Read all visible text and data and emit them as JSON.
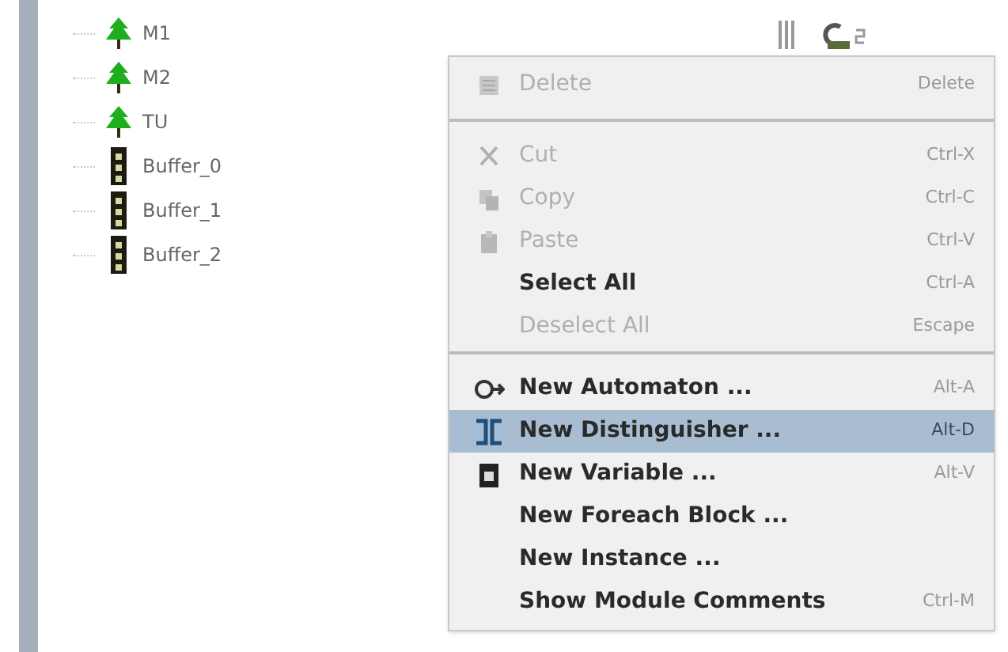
{
  "tree": {
    "items": [
      {
        "label": "M1",
        "kind": "tree"
      },
      {
        "label": "M2",
        "kind": "tree"
      },
      {
        "label": "TU",
        "kind": "tree"
      },
      {
        "label": "Buffer_0",
        "kind": "buffer"
      },
      {
        "label": "Buffer_1",
        "kind": "buffer"
      },
      {
        "label": "Buffer_2",
        "kind": "buffer"
      }
    ]
  },
  "menu": {
    "groups": [
      [
        {
          "label": "Delete",
          "shortcut": "Delete",
          "disabled": true,
          "bold": false,
          "selected": false
        }
      ],
      [
        {
          "label": "Cut",
          "shortcut": "Ctrl-X",
          "disabled": true,
          "bold": false,
          "selected": false
        },
        {
          "label": "Copy",
          "shortcut": "Ctrl-C",
          "disabled": true,
          "bold": false,
          "selected": false
        },
        {
          "label": "Paste",
          "shortcut": "Ctrl-V",
          "disabled": true,
          "bold": false,
          "selected": false
        },
        {
          "label": "Select All",
          "shortcut": "Ctrl-A",
          "disabled": false,
          "bold": true,
          "selected": false
        },
        {
          "label": "Deselect All",
          "shortcut": "Escape",
          "disabled": true,
          "bold": false,
          "selected": false
        }
      ],
      [
        {
          "label": "New Automaton ...",
          "shortcut": "Alt-A",
          "disabled": false,
          "bold": true,
          "selected": false
        },
        {
          "label": "New Distinguisher ...",
          "shortcut": "Alt-D",
          "disabled": false,
          "bold": true,
          "selected": true
        },
        {
          "label": "New Variable ...",
          "shortcut": "Alt-V",
          "disabled": false,
          "bold": true,
          "selected": false
        },
        {
          "label": "New Foreach Block ...",
          "disabled": false,
          "bold": true,
          "selected": false
        },
        {
          "label": "New Instance ...",
          "disabled": false,
          "bold": true,
          "selected": false
        },
        {
          "label": "Show Module Comments",
          "shortcut": "Ctrl-M",
          "disabled": false,
          "bold": true,
          "selected": false
        }
      ]
    ]
  }
}
